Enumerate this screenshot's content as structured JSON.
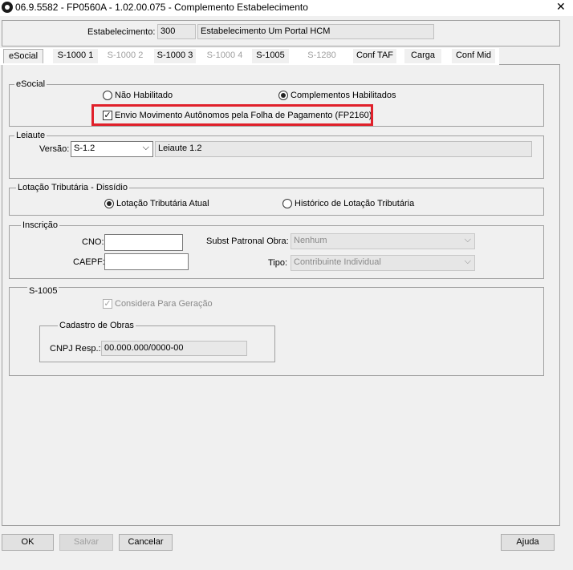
{
  "window": {
    "title": "06.9.5582 - FP0560A - 1.02.00.075 - Complemento Estabelecimento"
  },
  "header": {
    "estabelecimento_label": "Estabelecimento:",
    "estabelecimento_code": "300",
    "estabelecimento_name": "Estabelecimento Um Portal HCM"
  },
  "tabs": [
    {
      "label": "eSocial",
      "state": "active"
    },
    {
      "label": "S-1000 1",
      "state": "enabled"
    },
    {
      "label": "S-1000 2",
      "state": "disabled"
    },
    {
      "label": "S-1000 3",
      "state": "enabled"
    },
    {
      "label": "S-1000 4",
      "state": "disabled"
    },
    {
      "label": "S-1005",
      "state": "enabled"
    },
    {
      "label": "S-1280",
      "state": "disabled"
    },
    {
      "label": "Conf TAF",
      "state": "enabled"
    },
    {
      "label": "Carga",
      "state": "enabled"
    },
    {
      "label": "Conf Mid",
      "state": "enabled"
    }
  ],
  "esocial_group": {
    "title": "eSocial",
    "radio_nao": "Não Habilitado",
    "radio_complementos": "Complementos Habilitados",
    "checkbox_envio": "Envio Movimento Autônomos pela Folha de Pagamento (FP2160)"
  },
  "leiaute_group": {
    "title": "Leiaute",
    "versao_label": "Versão:",
    "versao_value": "S-1.2",
    "versao_desc": "Leiaute 1.2"
  },
  "lotacao_group": {
    "title": "Lotação Tributária - Dissídio",
    "radio_atual": "Lotação Tributária Atual",
    "radio_historico": "Histórico de Lotação Tributária"
  },
  "inscricao_group": {
    "title": "Inscrição",
    "cno_label": "CNO:",
    "caepf_label": "CAEPF:",
    "subst_label": "Subst Patronal Obra:",
    "subst_value": "Nenhum",
    "tipo_label": "Tipo:",
    "tipo_value": "Contribuinte Individual"
  },
  "s1005_group": {
    "title": "S-1005",
    "considera_label": "Considera Para Geração",
    "cadastro_title": "Cadastro de Obras",
    "cnpj_label": "CNPJ Resp.:",
    "cnpj_value": "00.000.000/0000-00"
  },
  "buttons": {
    "ok": "OK",
    "salvar": "Salvar",
    "cancelar": "Cancelar",
    "ajuda": "Ajuda"
  },
  "colors": {
    "highlight": "#e0202a"
  }
}
